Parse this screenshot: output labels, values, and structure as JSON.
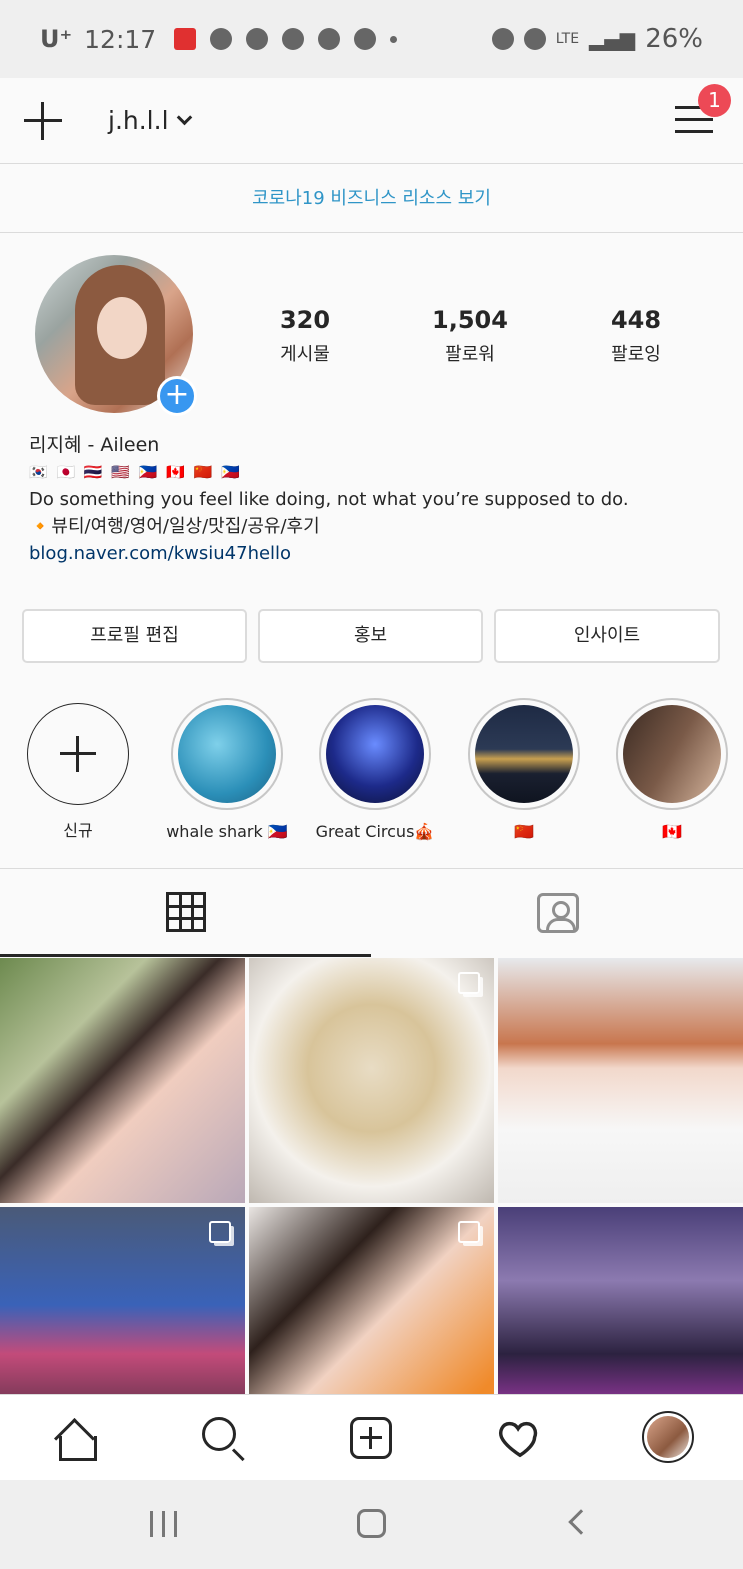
{
  "status_bar": {
    "carrier": "U⁺",
    "time": "12:17",
    "battery": "26%",
    "network": "LTE"
  },
  "header": {
    "username": "j.h.l.l",
    "notification_count": "1"
  },
  "banner": {
    "text": "코로나19 비즈니스 리소스 보기"
  },
  "profile": {
    "stats": [
      {
        "value": "320",
        "label": "게시물"
      },
      {
        "value": "1,504",
        "label": "팔로워"
      },
      {
        "value": "448",
        "label": "팔로잉"
      }
    ],
    "name": "리지혜 - Aileen",
    "flags": "🇰🇷 🇯🇵 🇹🇭 🇺🇸 🇵🇭 🇨🇦 🇨🇳 🇵🇭",
    "bio_line1": "Do something you feel like doing, not what you’re supposed to do.",
    "bio_line2": "🔸뷰티/여행/영어/일상/맛집/공유/후기",
    "link": "blog.naver.com/kwsiu47hello"
  },
  "buttons": {
    "edit_profile": "프로필 편집",
    "promote": "홍보",
    "insights": "인사이트"
  },
  "highlights": [
    {
      "label": "신규"
    },
    {
      "label": "whale shark 🇵🇭"
    },
    {
      "label": "Great Circus🎪"
    },
    {
      "label": "🇨🇳"
    },
    {
      "label": "🇨🇦"
    }
  ],
  "colors": {
    "accent_blue": "#3897f0",
    "badge_red": "#ed4956",
    "link_blue": "#003569",
    "banner_blue": "#2f95c7"
  }
}
